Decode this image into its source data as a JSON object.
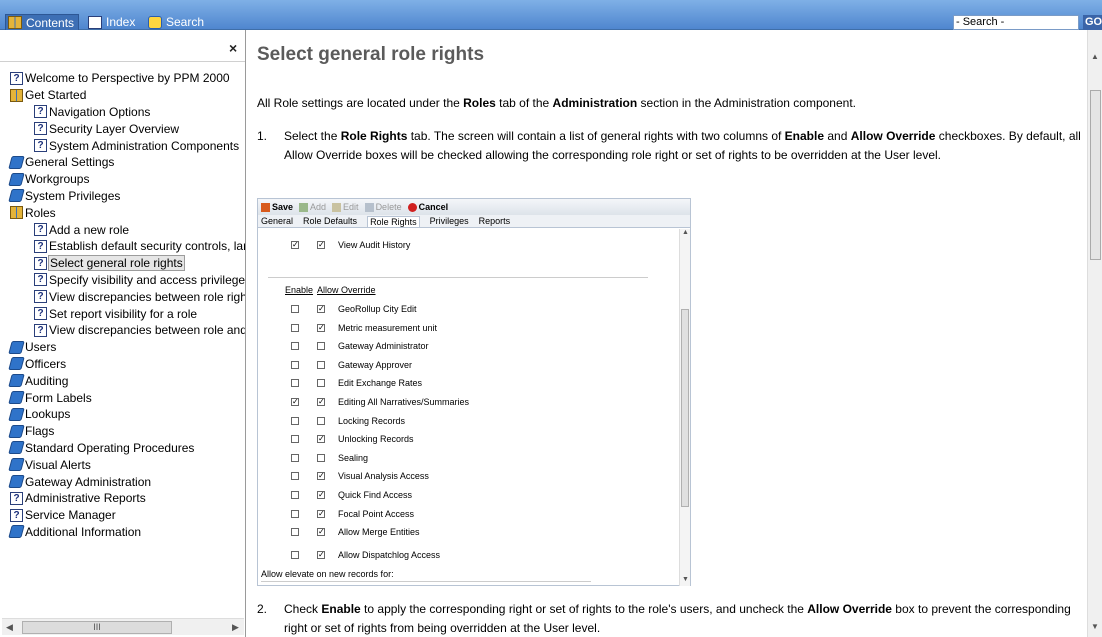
{
  "toolbar": {
    "tabs": [
      {
        "label": "Contents",
        "icon": "contents-book-icon"
      },
      {
        "label": "Index",
        "icon": "index-icon"
      },
      {
        "label": "Search",
        "icon": "search-bubble-icon"
      }
    ],
    "search_placeholder": "- Search -",
    "go_label": "GO"
  },
  "left": {
    "close_label": "×",
    "tree": [
      {
        "label": "Welcome to Perspective by PPM 2000",
        "icon": "topic",
        "level": 0
      },
      {
        "label": "Get Started",
        "icon": "open-book",
        "level": 0
      },
      {
        "label": "Navigation Options",
        "icon": "topic",
        "level": 1
      },
      {
        "label": "Security Layer Overview",
        "icon": "topic",
        "level": 1
      },
      {
        "label": "System Administration Components",
        "icon": "topic",
        "level": 1
      },
      {
        "label": "General Settings",
        "icon": "closed-book",
        "level": 0
      },
      {
        "label": "Workgroups",
        "icon": "closed-book",
        "level": 0
      },
      {
        "label": "System Privileges",
        "icon": "closed-book",
        "level": 0
      },
      {
        "label": "Roles",
        "icon": "open-book",
        "level": 0
      },
      {
        "label": "Add a new role",
        "icon": "topic",
        "level": 1
      },
      {
        "label": "Establish default security controls, langu",
        "icon": "topic",
        "level": 1
      },
      {
        "label": "Select general role rights",
        "icon": "topic",
        "level": 1,
        "selected": true
      },
      {
        "label": "Specify visibility and access privileges",
        "icon": "topic",
        "level": 1
      },
      {
        "label": "View discrepancies between role rights",
        "icon": "topic",
        "level": 1
      },
      {
        "label": "Set report visibility for a role",
        "icon": "topic",
        "level": 1
      },
      {
        "label": "View discrepancies between role and",
        "icon": "topic",
        "level": 1
      },
      {
        "label": "Users",
        "icon": "closed-book",
        "level": 0
      },
      {
        "label": "Officers",
        "icon": "closed-book",
        "level": 0
      },
      {
        "label": "Auditing",
        "icon": "closed-book",
        "level": 0
      },
      {
        "label": "Form Labels",
        "icon": "closed-book",
        "level": 0
      },
      {
        "label": "Lookups",
        "icon": "closed-book",
        "level": 0
      },
      {
        "label": "Flags",
        "icon": "closed-book",
        "level": 0
      },
      {
        "label": "Standard Operating Procedures",
        "icon": "closed-book",
        "level": 0
      },
      {
        "label": "Visual Alerts",
        "icon": "closed-book",
        "level": 0
      },
      {
        "label": "Gateway Administration",
        "icon": "closed-book",
        "level": 0
      },
      {
        "label": "Administrative Reports",
        "icon": "topic",
        "level": 0
      },
      {
        "label": "Service Manager",
        "icon": "topic",
        "level": 0
      },
      {
        "label": "Additional Information",
        "icon": "closed-book",
        "level": 0
      }
    ],
    "hscroll_thumb": "III"
  },
  "content": {
    "title": "Select general role rights",
    "intro": [
      {
        "t": "All Role settings are located under the "
      },
      {
        "t": "Roles",
        "b": true
      },
      {
        "t": " tab of the "
      },
      {
        "t": "Administration",
        "b": true
      },
      {
        "t": " section in the Administration component."
      }
    ],
    "step1_num": "1.",
    "step1": [
      {
        "t": "Select the "
      },
      {
        "t": "Role Rights",
        "b": true
      },
      {
        "t": " tab. The screen will contain a list of general rights with two columns of "
      },
      {
        "t": "Enable",
        "b": true
      },
      {
        "t": " and "
      },
      {
        "t": "Allow Override",
        "b": true
      },
      {
        "t": " checkboxes. By default, all Allow Override boxes will be checked allowing the corresponding role right or set of rights to be overridden at the User level."
      }
    ],
    "step2_num": "2.",
    "step2": [
      {
        "t": "Check "
      },
      {
        "t": "Enable",
        "b": true
      },
      {
        "t": " to apply the corresponding right or set of rights to the role's users, and uncheck the "
      },
      {
        "t": "Allow Override",
        "b": true
      },
      {
        "t": " box to prevent the corresponding right or set of rights from being overridden at the User level."
      }
    ]
  },
  "screenshot": {
    "toolbar": [
      {
        "label": "Save",
        "enabled": true,
        "icon": "save-icon"
      },
      {
        "label": "Add",
        "enabled": false,
        "icon": "add-icon"
      },
      {
        "label": "Edit",
        "enabled": false,
        "icon": "edit-icon"
      },
      {
        "label": "Delete",
        "enabled": false,
        "icon": "delete-icon"
      },
      {
        "label": "Cancel",
        "enabled": true,
        "icon": "cancel-icon"
      }
    ],
    "tabs": [
      "General",
      "Role Defaults",
      "Role Rights",
      "Privileges",
      "Reports"
    ],
    "active_tab": "Role Rights",
    "top_row": {
      "enable": true,
      "override": true,
      "label": "View Audit History"
    },
    "col_enable": "Enable",
    "col_override": "Allow Override",
    "rows": [
      {
        "enable": false,
        "override": true,
        "label": "GeoRollup City Edit"
      },
      {
        "enable": false,
        "override": true,
        "label": "Metric measurement unit"
      },
      {
        "enable": false,
        "override": false,
        "label": "Gateway Administrator"
      },
      {
        "enable": false,
        "override": false,
        "label": "Gateway Approver"
      },
      {
        "enable": false,
        "override": false,
        "label": "Edit Exchange Rates"
      },
      {
        "enable": true,
        "override": true,
        "label": "Editing All Narratives/Summaries"
      },
      {
        "enable": false,
        "override": false,
        "label": "Locking Records"
      },
      {
        "enable": false,
        "override": true,
        "label": "Unlocking Records"
      },
      {
        "enable": false,
        "override": false,
        "label": "Sealing"
      },
      {
        "enable": false,
        "override": true,
        "label": "Visual Analysis Access"
      },
      {
        "enable": false,
        "override": true,
        "label": "Quick Find Access"
      },
      {
        "enable": false,
        "override": true,
        "label": "Focal Point Access"
      },
      {
        "enable": false,
        "override": true,
        "label": "Allow Merge Entities"
      }
    ],
    "last_row": {
      "enable": false,
      "override": true,
      "label": "Allow Dispatchlog Access"
    },
    "elevate_label": "Allow elevate on new records for:"
  }
}
